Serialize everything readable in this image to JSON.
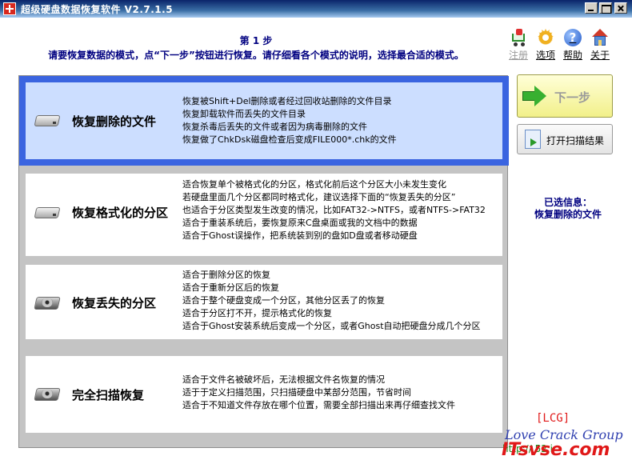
{
  "window": {
    "title": "超级硬盘数据恢复软件 V2.7.1.5",
    "buttons": [
      "minimize",
      "maximize",
      "close"
    ]
  },
  "header": {
    "step": "第 1 步",
    "instruction": "请要恢复数据的模式，点“下一步”按钮进行恢复。请仔细看各个模式的说明，选择最合适的模式。"
  },
  "toolbar": {
    "register": {
      "label": "注册",
      "icon": "cart-icon",
      "enabled": false
    },
    "options": {
      "label": "选项",
      "icon": "gear-icon"
    },
    "help": {
      "label": "帮助",
      "icon": "help-icon"
    },
    "about": {
      "label": "关于",
      "icon": "home-icon"
    }
  },
  "options": [
    {
      "name": "恢复删除的文件",
      "icon": "drive-icon",
      "selected": true,
      "lines": [
        "恢复被Shift+Del删除或者经过回收站删除的文件目录",
        "恢复卸载软件而丢失的文件目录",
        "恢复杀毒后丢失的文件或者因为病毒删除的文件",
        "恢复做了ChkDsk磁盘检查后变成FILE000*.chk的文件"
      ]
    },
    {
      "name": "恢复格式化的分区",
      "icon": "drive-icon",
      "selected": false,
      "lines": [
        "适合恢复单个被格式化的分区，格式化前后这个分区大小未发生变化",
        "若硬盘里面几个分区都同时格式化，建议选择下面的“恢复丢失的分区”",
        "也适合于分区类型发生改变的情况，比如FAT32->NTFS，或者NTFS->FAT32",
        "适合于重装系统后，要恢复原来C盘桌面或我的文档中的数据",
        "适合于Ghost误操作，把系统装到别的盘如D盘或者移动硬盘"
      ]
    },
    {
      "name": "恢复丢失的分区",
      "icon": "hard-disk-icon",
      "selected": false,
      "lines": [
        "适合于删除分区的恢复",
        "适合于重新分区后的恢复",
        "适合于整个硬盘变成一个分区，其他分区丢了的恢复",
        "适合于分区打不开，提示格式化的恢复",
        "适合于Ghost安装系统后变成一个分区，或者Ghost自动把硬盘分成几个分区"
      ]
    },
    {
      "name": "完全扫描恢复",
      "icon": "hard-disk-icon",
      "selected": false,
      "lines": [
        "适合于文件名被破坏后，无法根据文件名恢复的情况",
        "适于于定义扫描范围，只扫描硬盘中某部分范围，节省时间",
        "适合于不知道文件存放在哪个位置，需要全部扫描出来再仔细查找文件"
      ]
    }
  ],
  "actions": {
    "next": "下一步",
    "open_scan": "打开扫描结果"
  },
  "selection_info": {
    "label": "已选信息：",
    "value": "恢复删除的文件"
  },
  "watermark": {
    "lcg": "[LCG]",
    "group": "Love Crack Group",
    "site": "ITsvse.com",
    "url": "http://  52  i"
  },
  "colors": {
    "title_gradient_start": "#0a246a",
    "accent_blue": "#3a64e0",
    "selected_bg": "#ccdeff",
    "header_text": "#000080",
    "next_button": "#f2f08a"
  }
}
